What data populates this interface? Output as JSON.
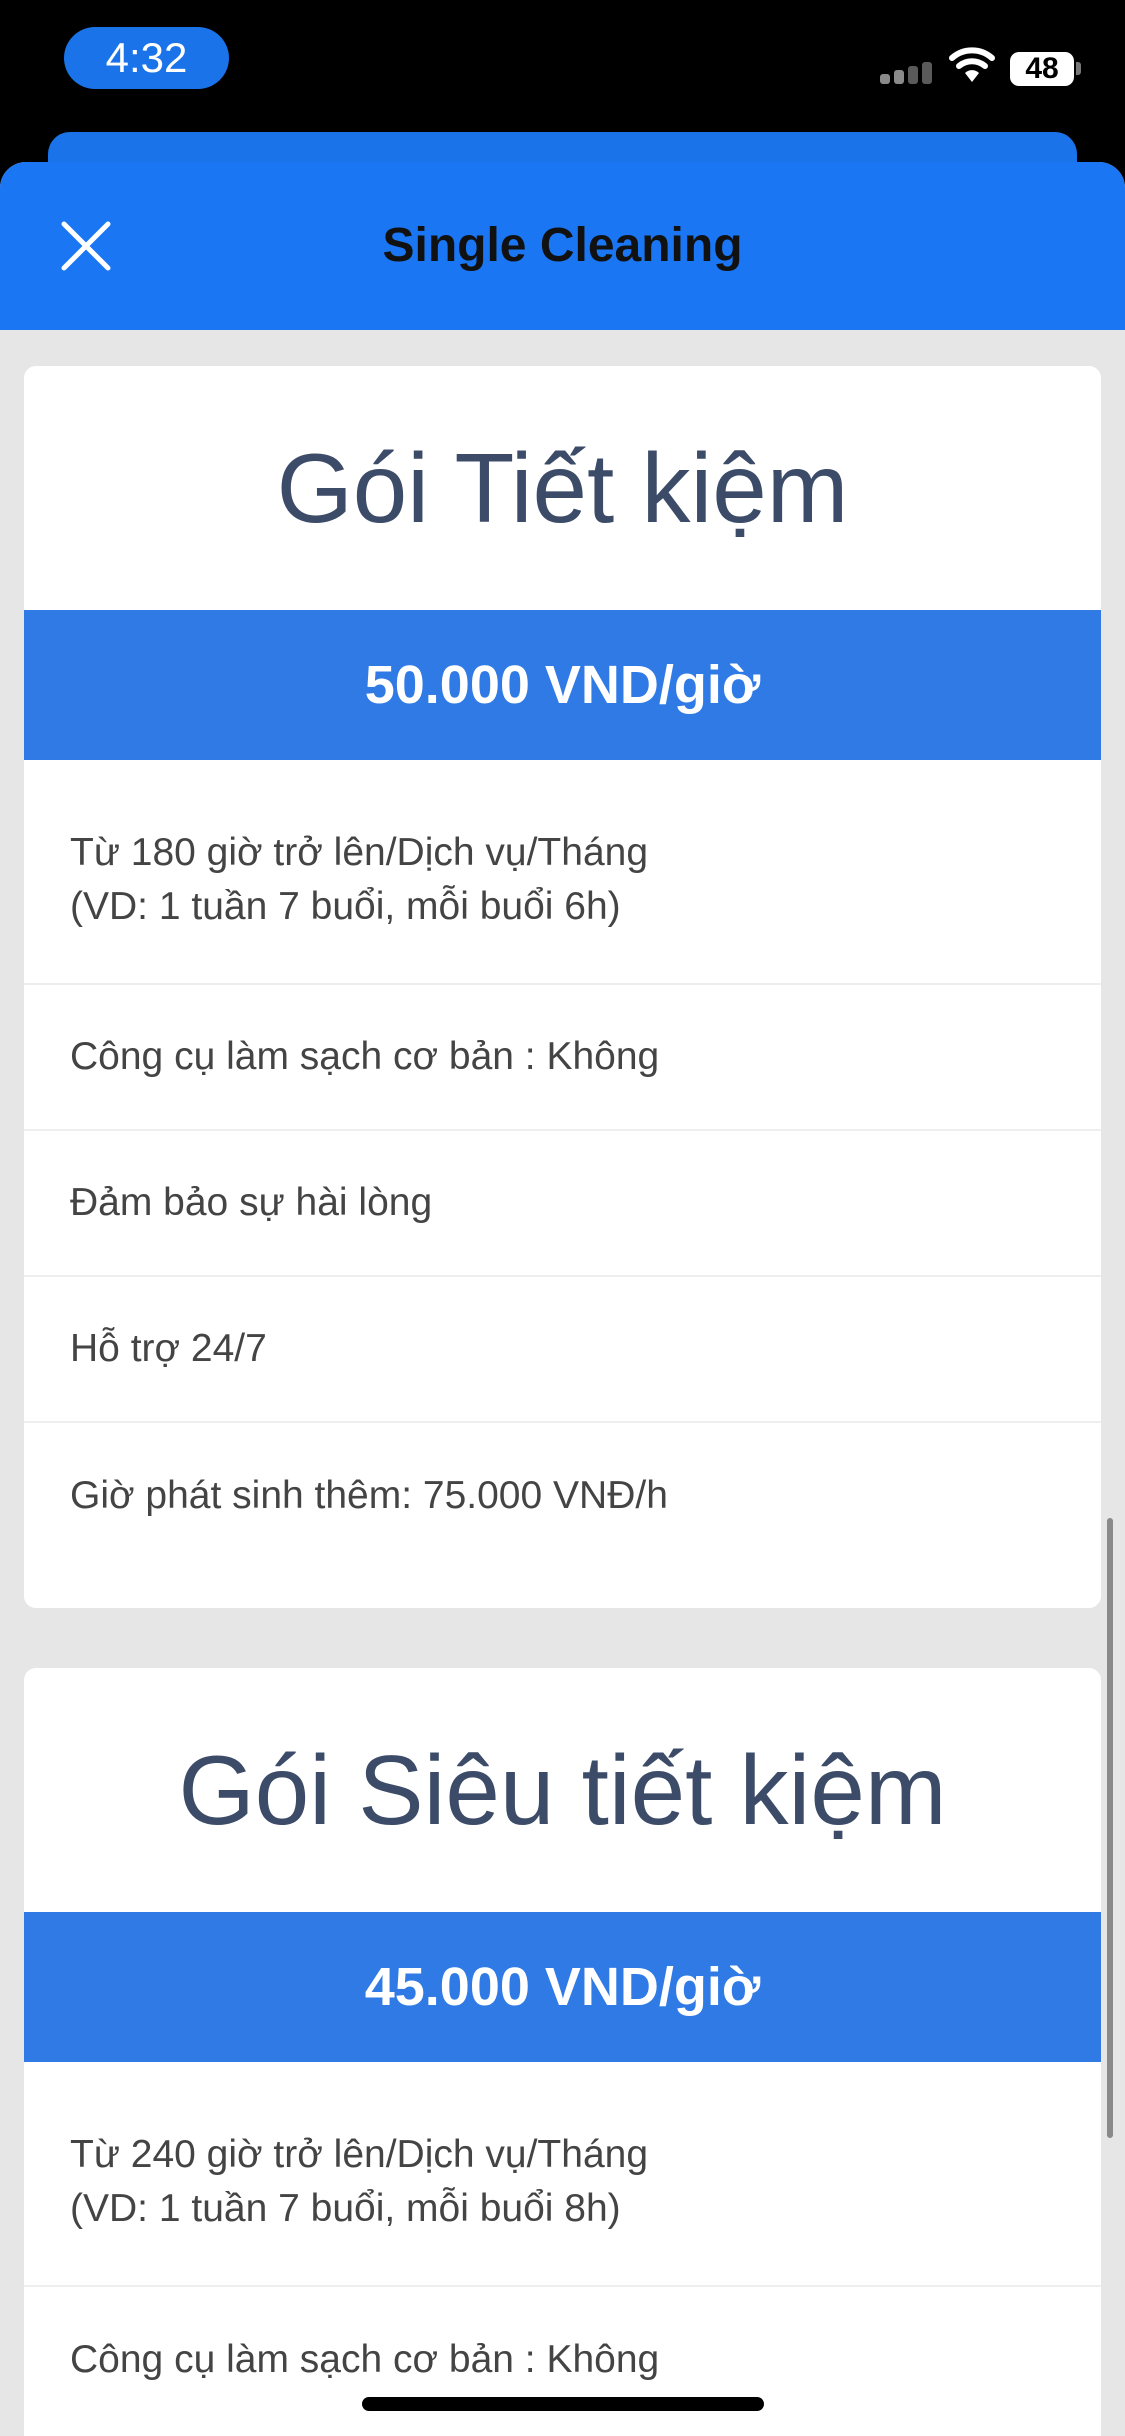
{
  "status_bar": {
    "time": "4:32",
    "battery": "48"
  },
  "header": {
    "title": "Single Cleaning",
    "close_icon": "close-icon"
  },
  "colors": {
    "accent": "#1a76f2",
    "price_band": "#2f7ae5",
    "title_text": "#3c4b68",
    "background": "#e6e6e6"
  },
  "cards": [
    {
      "title": "Gói Tiết kiệm",
      "price": "50.000 VND/giờ",
      "features": [
        "Từ 180 giờ trở lên/Dịch vụ/Tháng",
        "(VD: 1 tuần 7 buổi, mỗi buổi 6h)",
        "Công cụ làm sạch cơ bản : Không",
        "Đảm bảo sự hài lòng",
        "Hỗ trợ 24/7",
        "Giờ phát sinh thêm: 75.000 VNĐ/h"
      ]
    },
    {
      "title": "Gói Siêu tiết kiệm",
      "price": "45.000 VND/giờ",
      "features": [
        "Từ 240 giờ trở lên/Dịch vụ/Tháng",
        "(VD: 1 tuần 7 buổi, mỗi buổi 8h)",
        "Công cụ làm sạch cơ bản : Không"
      ]
    }
  ]
}
